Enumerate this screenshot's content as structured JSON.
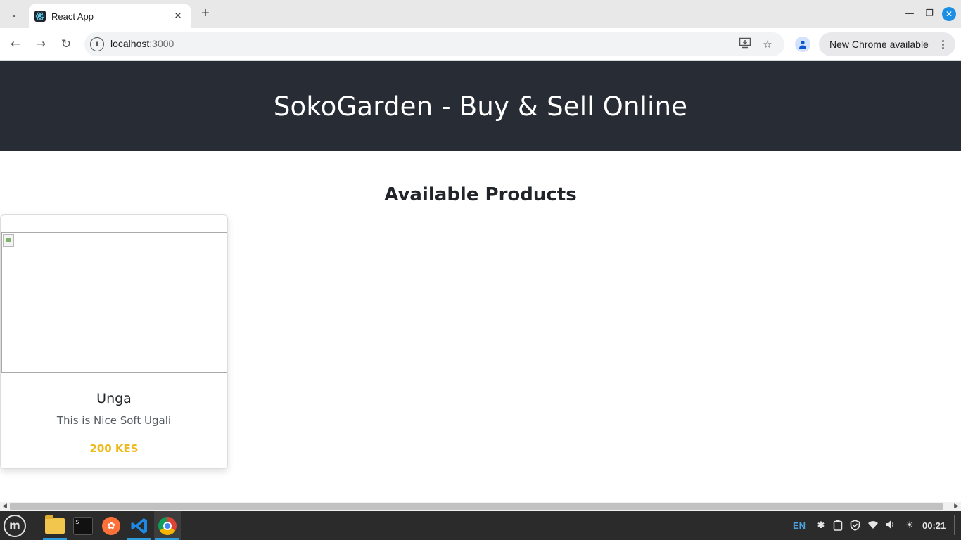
{
  "browser": {
    "tab_title": "React App",
    "url_host": "localhost",
    "url_port": ":3000",
    "update_label": "New Chrome available"
  },
  "app": {
    "header_title": "SokoGarden - Buy & Sell Online",
    "section_title": "Available Products",
    "products": [
      {
        "name": "Unga",
        "description": "This is Nice Soft Ugali",
        "price": "200 KES"
      }
    ]
  },
  "taskbar": {
    "language": "EN",
    "clock": "00:21"
  },
  "colors": {
    "header_bg": "#282c34",
    "price": "#f0b91b",
    "accent": "#1a8fe3"
  },
  "icons": [
    "tab-search-icon",
    "react-favicon-icon",
    "close-icon",
    "plus-icon",
    "back-arrow-icon",
    "forward-arrow-icon",
    "reload-icon",
    "site-info-icon",
    "install-app-icon",
    "bookmark-star-icon",
    "profile-icon",
    "more-vert-icon",
    "mint-menu-icon",
    "files-icon",
    "terminal-icon",
    "firefox-icon",
    "vscode-icon",
    "chrome-icon",
    "bluetooth-icon",
    "clipboard-icon",
    "shield-icon",
    "wifi-icon",
    "volume-icon",
    "brightness-icon"
  ]
}
